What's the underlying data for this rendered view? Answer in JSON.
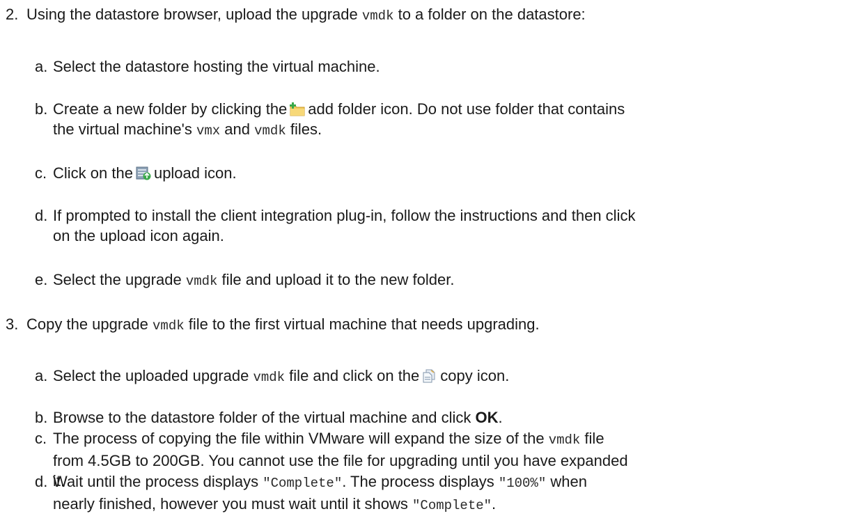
{
  "step2": {
    "num": "2.",
    "pre": "Using the datastore browser, upload the upgrade ",
    "code": "vmdk",
    "post": " to a folder on the datastore:",
    "subs": {
      "a": {
        "letter": "a.",
        "text": "Select the datastore hosting the virtual machine."
      },
      "b": {
        "letter": "b.",
        "t1": "Create a new folder by clicking the",
        "t2": "add folder icon. Do not use folder that contains",
        "t3": "the virtual machine's ",
        "c1": "vmx",
        "t4": " and ",
        "c2": "vmdk",
        "t5": " files."
      },
      "c": {
        "letter": "c.",
        "t1": "Click on the",
        "t2": "upload icon."
      },
      "d": {
        "letter": "d.",
        "l1": "If prompted to install the client integration plug-in, follow the instructions and then click",
        "l2": "on the upload icon again."
      },
      "e": {
        "letter": "e.",
        "t1": "Select the upgrade ",
        "c1": "vmdk",
        "t2": " file and upload it to the new folder."
      }
    }
  },
  "step3": {
    "num": "3.",
    "pre": "Copy the upgrade ",
    "code": "vmdk",
    "post": " file to the first virtual machine that needs upgrading.",
    "subs": {
      "a": {
        "letter": "a.",
        "t1": "Select the uploaded upgrade ",
        "c1": "vmdk",
        "t2": " file and click on the",
        "t3": "copy icon."
      },
      "b": {
        "letter": "b.",
        "t1": "Browse to the datastore folder of the virtual machine and click ",
        "bold": "OK",
        "t2": "."
      },
      "c": {
        "letter": "c.",
        "t1": "The process of copying the file within VMware will expand the size of the ",
        "c1": "vmdk",
        "t2": " file",
        "l2": "from 4.5GB to 200GB. You cannot use the file for upgrading until you have expanded",
        "l3": "it."
      },
      "d": {
        "letter": "d.",
        "t1": "Wait until the process displays ",
        "c1": "\"Complete\"",
        "t2": ". The process displays ",
        "c2": "\"100%\"",
        "t3": " when",
        "t4": "nearly finished, however you must wait until it shows ",
        "c3": "\"Complete\"",
        "t5": "."
      }
    }
  },
  "icons": {
    "add_folder": "add-folder-icon",
    "upload": "upload-icon",
    "copy": "copy-icon"
  }
}
